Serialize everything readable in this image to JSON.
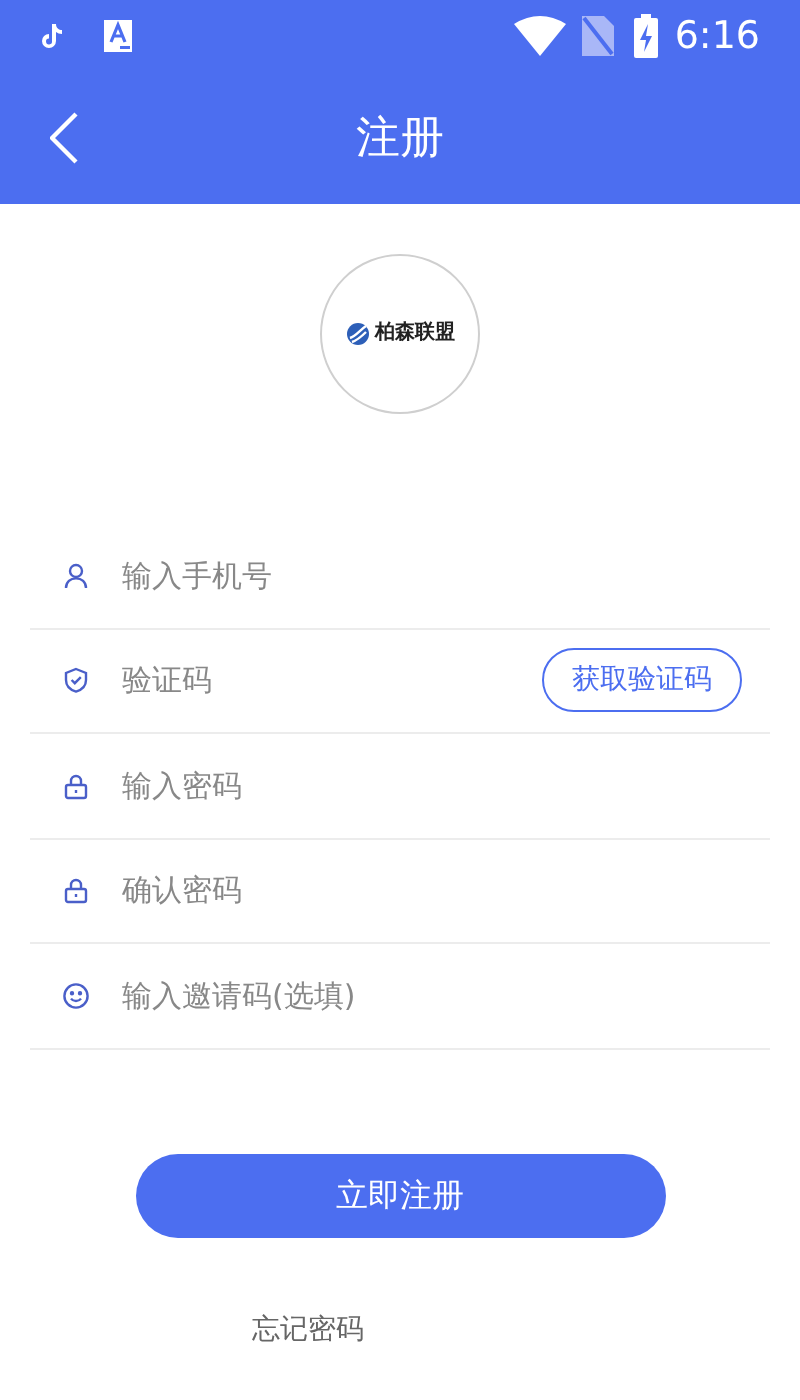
{
  "status_bar": {
    "time": "6:16"
  },
  "header": {
    "title": "注册"
  },
  "logo": {
    "text": "柏森联盟"
  },
  "fields": [
    {
      "kind": "phone",
      "placeholder": "输入手机号"
    },
    {
      "kind": "code",
      "placeholder": "验证码",
      "button": "获取验证码"
    },
    {
      "kind": "password",
      "placeholder": "输入密码"
    },
    {
      "kind": "password",
      "placeholder": "确认密码"
    },
    {
      "kind": "invite",
      "placeholder": "输入邀请码(选填)"
    }
  ],
  "submit": "立即注册",
  "forgot": "忘记密码"
}
